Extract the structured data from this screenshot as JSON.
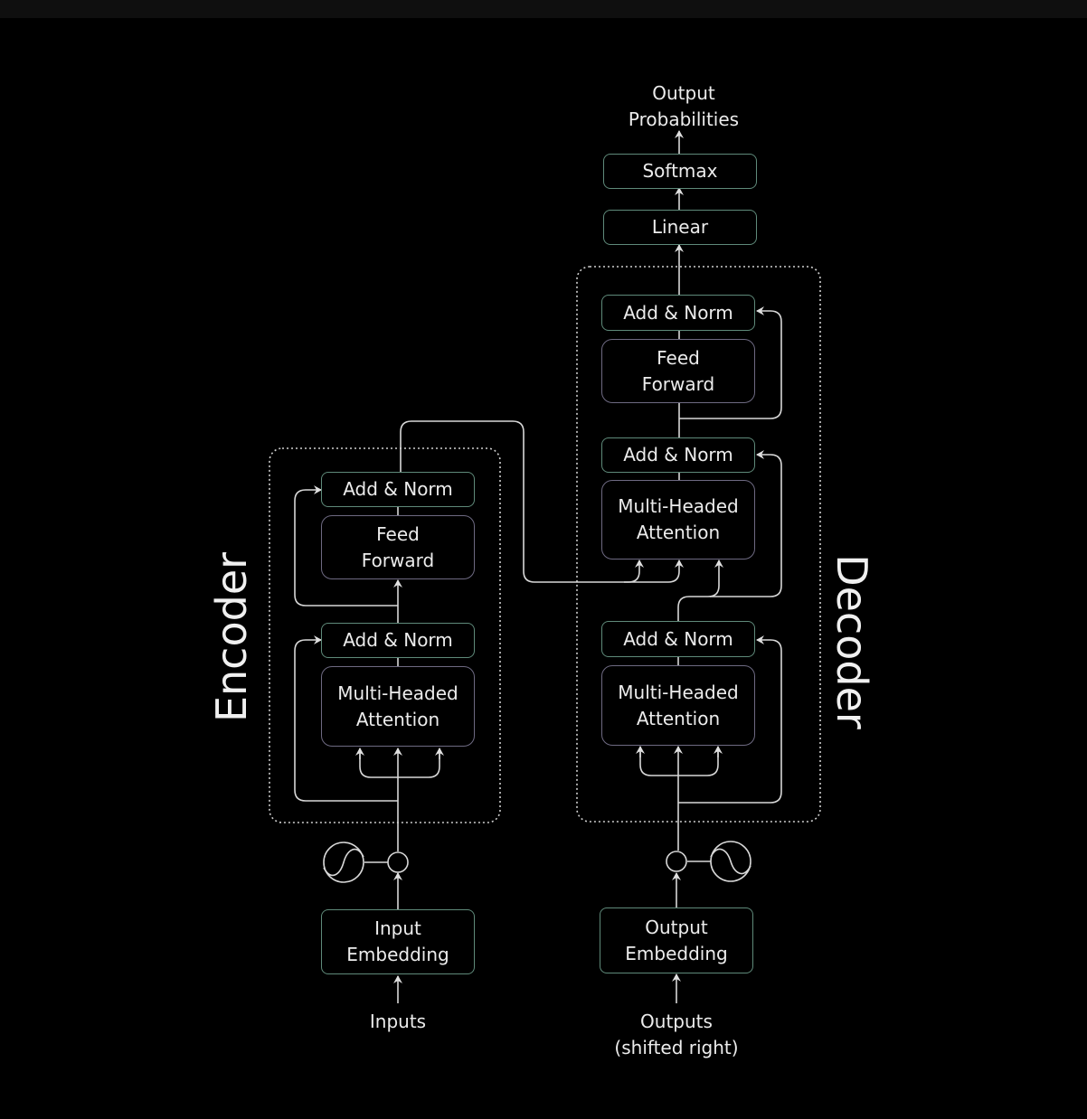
{
  "colors": {
    "background": "#000000",
    "top_bar": "#0f0f0f",
    "box_border_green": "#5f8a7a",
    "box_border_purple": "#6e6a82",
    "line": "#d8d8d8",
    "text": "#ececec"
  },
  "sections": {
    "encoder_label": "Encoder",
    "decoder_label": "Decoder"
  },
  "top": {
    "output_line1": "Output",
    "output_line2": "Probabilities",
    "softmax": "Softmax",
    "linear": "Linear"
  },
  "encoder": {
    "add_norm_top": "Add & Norm",
    "feed_forward_line1": "Feed",
    "feed_forward_line2": "Forward",
    "add_norm_bottom": "Add & Norm",
    "attention_line1": "Multi-Headed",
    "attention_line2": "Attention",
    "embedding_line1": "Input",
    "embedding_line2": "Embedding",
    "input_label": "Inputs",
    "positional_encoding_icon": "sine-wave-icon"
  },
  "decoder": {
    "add_norm_top": "Add & Norm",
    "feed_forward_line1": "Feed",
    "feed_forward_line2": "Forward",
    "add_norm_middle": "Add & Norm",
    "cross_attention_line1": "Multi-Headed",
    "cross_attention_line2": "Attention",
    "add_norm_bottom": "Add & Norm",
    "self_attention_line1": "Multi-Headed",
    "self_attention_line2": "Attention",
    "embedding_line1": "Output",
    "embedding_line2": "Embedding",
    "output_label_line1": "Outputs",
    "output_label_line2": "(shifted right)",
    "positional_encoding_icon": "sine-wave-icon"
  }
}
